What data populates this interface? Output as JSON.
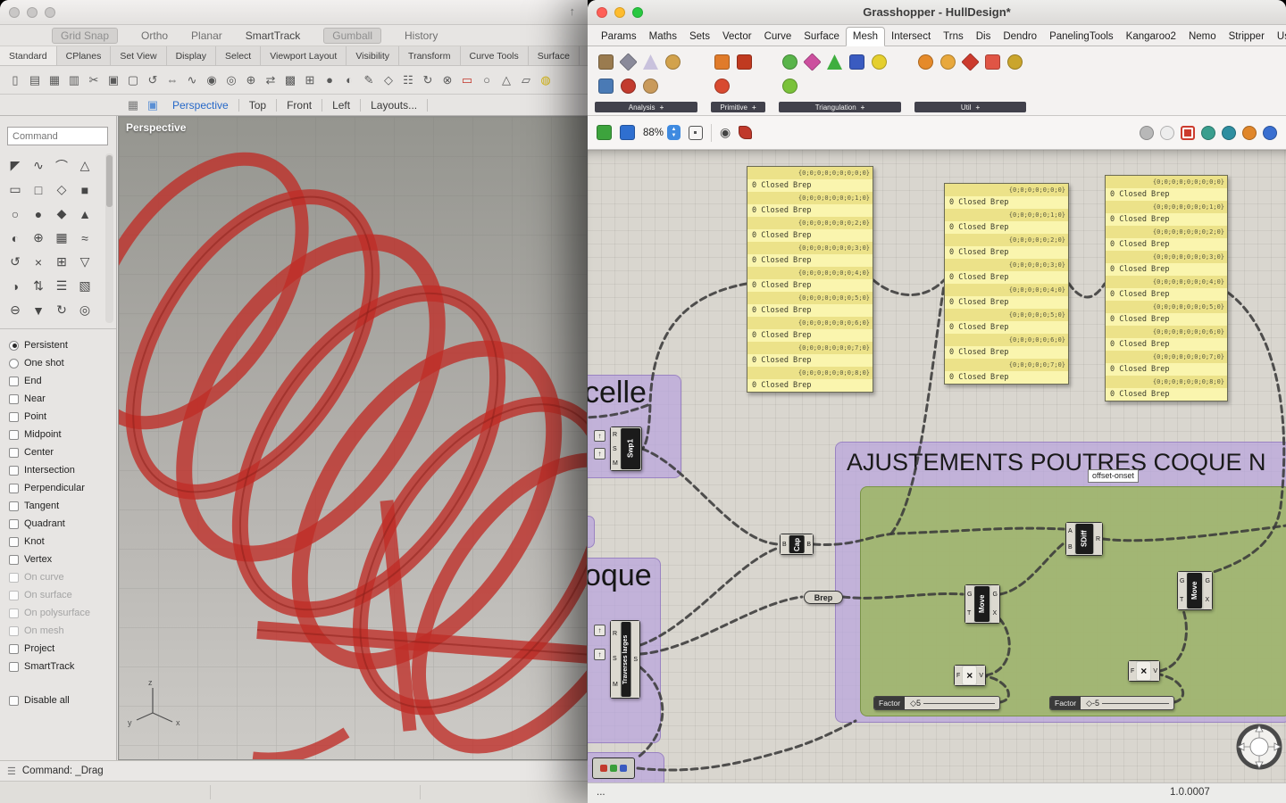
{
  "colors": {
    "accent_blue": "#3f8ae0",
    "panel_yellow": "#f8f2a0",
    "group_purple": "#b9a3dd",
    "group_green": "#9fb668",
    "wire": "#3a3a3a",
    "red_geometry": "#c03028"
  },
  "rhino": {
    "share_icon": "↑",
    "toggles": [
      {
        "label": "Grid Snap",
        "cls": "boxed"
      },
      {
        "label": "Ortho",
        "cls": "plain"
      },
      {
        "label": "Planar",
        "cls": "plain"
      },
      {
        "label": "SmartTrack",
        "cls": "strong"
      },
      {
        "label": "Gumball",
        "cls": "boxed"
      },
      {
        "label": "History",
        "cls": "plain"
      }
    ],
    "tabs": [
      {
        "label": "Standard",
        "cls": "first"
      },
      {
        "label": "CPlanes"
      },
      {
        "label": "Set View"
      },
      {
        "label": "Display"
      },
      {
        "label": "Select"
      },
      {
        "label": "Viewport Layout"
      },
      {
        "label": "Visibility"
      },
      {
        "label": "Transform"
      },
      {
        "label": "Curve Tools"
      },
      {
        "label": "Surface"
      }
    ],
    "toolbar_icons": [
      {
        "g": "▯"
      },
      {
        "g": "▤"
      },
      {
        "g": "▦"
      },
      {
        "g": "▥"
      },
      {
        "g": "✂"
      },
      {
        "g": "▣"
      },
      {
        "g": "▢"
      },
      {
        "g": "↺"
      },
      {
        "g": "⇔"
      },
      {
        "g": "∿"
      },
      {
        "g": "◉"
      },
      {
        "g": "◎"
      },
      {
        "g": "⊕"
      },
      {
        "g": "⇄"
      },
      {
        "g": "▩"
      },
      {
        "g": "⊞"
      },
      {
        "g": "●"
      },
      {
        "g": "◐"
      },
      {
        "g": "✎"
      },
      {
        "g": "◇"
      },
      {
        "g": "☷"
      },
      {
        "g": "↻"
      },
      {
        "g": "⊗"
      },
      {
        "g": "▭",
        "c": "#c23428"
      },
      {
        "g": "○"
      },
      {
        "g": "△"
      },
      {
        "g": "▱"
      },
      {
        "g": "◍",
        "c": "#d8b812"
      }
    ],
    "command_placeholder": "Command",
    "vp_icons": {
      "grid": "▦",
      "frame": "▣"
    },
    "viewport_tabs": [
      {
        "label": "Perspective",
        "cls": "active"
      },
      {
        "label": "Top"
      },
      {
        "label": "Front"
      },
      {
        "label": "Left"
      },
      {
        "label": "Layouts..."
      }
    ],
    "viewport_label": "Perspective",
    "side_icons": [
      {
        "g": "◤"
      },
      {
        "g": "∿"
      },
      {
        "g": "⌒"
      },
      {
        "g": "△"
      },
      {
        "g": "▭"
      },
      {
        "g": "□"
      },
      {
        "g": "◇"
      },
      {
        "g": "■"
      },
      {
        "g": "○"
      },
      {
        "g": "●"
      },
      {
        "g": "◆"
      },
      {
        "g": "▲"
      },
      {
        "g": "◐"
      },
      {
        "g": "⊕"
      },
      {
        "g": "▦"
      },
      {
        "g": "≈"
      },
      {
        "g": "↺"
      },
      {
        "g": "×"
      },
      {
        "g": "⊞"
      },
      {
        "g": "▽"
      },
      {
        "g": "◑"
      },
      {
        "g": "⇅"
      },
      {
        "g": "☰"
      },
      {
        "g": "▧"
      },
      {
        "g": "⊖"
      },
      {
        "g": "▼"
      },
      {
        "g": "↻"
      },
      {
        "g": "◎"
      }
    ],
    "osnap": {
      "radios": [
        {
          "label": "Persistent",
          "cls": "checked"
        },
        {
          "label": "One shot"
        }
      ],
      "checks": [
        {
          "label": "End"
        },
        {
          "label": "Near"
        },
        {
          "label": "Point"
        },
        {
          "label": "Midpoint"
        },
        {
          "label": "Center"
        },
        {
          "label": "Intersection"
        },
        {
          "label": "Perpendicular"
        },
        {
          "label": "Tangent"
        },
        {
          "label": "Quadrant"
        },
        {
          "label": "Knot"
        },
        {
          "label": "Vertex"
        },
        {
          "label": "On curve",
          "cls": "disabled"
        },
        {
          "label": "On surface",
          "cls": "disabled"
        },
        {
          "label": "On polysurface",
          "cls": "disabled"
        },
        {
          "label": "On mesh",
          "cls": "disabled"
        },
        {
          "label": "Project"
        },
        {
          "label": "SmartTrack"
        }
      ],
      "disable_all": "Disable all"
    },
    "status_icon": "☰",
    "status": "Command: _Drag"
  },
  "grasshopper": {
    "title": "Grasshopper - HullDesign*",
    "menus": [
      {
        "label": "Params"
      },
      {
        "label": "Maths"
      },
      {
        "label": "Sets"
      },
      {
        "label": "Vector"
      },
      {
        "label": "Curve"
      },
      {
        "label": "Surface"
      },
      {
        "label": "Mesh",
        "cls": "active"
      },
      {
        "label": "Intersect"
      },
      {
        "label": "Trns"
      },
      {
        "label": "Dis"
      },
      {
        "label": "Dendro"
      },
      {
        "label": "PanelingTools"
      },
      {
        "label": "Kangaroo2"
      },
      {
        "label": "Nemo"
      },
      {
        "label": "Stripper"
      },
      {
        "label": "User"
      }
    ],
    "ribbon": [
      {
        "label": "Analysis",
        "icons": [
          {
            "c": "#9a7b4f",
            "shape": "square"
          },
          {
            "c": "#8a8a9a",
            "shape": "diamond"
          },
          {
            "c": "#c9c2dd",
            "shape": "tri"
          },
          {
            "c": "#d2a24c",
            "shape": "circle"
          },
          {
            "c": "#4a7ab5",
            "shape": "square"
          },
          {
            "c": "#c23b2e",
            "shape": "circle"
          },
          {
            "c": "#c99a5b",
            "shape": "circle"
          }
        ]
      },
      {
        "label": "Primitive",
        "icons": [
          {
            "c": "#e07b2a",
            "shape": "square"
          },
          {
            "c": "#c03a20",
            "shape": "square"
          },
          {
            "c": "#d84a30",
            "shape": "circle"
          }
        ]
      },
      {
        "label": "Triangulation",
        "icons": [
          {
            "c": "#59b44a",
            "shape": "circle"
          },
          {
            "c": "#cc4f9e",
            "shape": "diamond"
          },
          {
            "c": "#3fae3f",
            "shape": "tri"
          },
          {
            "c": "#3a5bc0",
            "shape": "square"
          },
          {
            "c": "#e5cf2e",
            "shape": "circle"
          },
          {
            "c": "#7ac23a",
            "shape": "circle"
          }
        ]
      },
      {
        "label": "Util",
        "icons": [
          {
            "c": "#e58a2a",
            "shape": "circle"
          },
          {
            "c": "#e8a83c",
            "shape": "circle"
          },
          {
            "c": "#cc3b2e",
            "shape": "diamond"
          },
          {
            "c": "#e05545",
            "shape": "square"
          },
          {
            "c": "#caa52c",
            "shape": "circle"
          }
        ]
      }
    ],
    "toolbar": {
      "zoom": "88%",
      "up": "▲",
      "down": "▼"
    },
    "view_icons": [
      {
        "c": "#b8b8b8"
      },
      {
        "c": "#ededed"
      },
      {
        "c": "#cc3b2e",
        "cls": "sel"
      },
      {
        "c": "#3a9e8e"
      },
      {
        "c": "#2e8ea0"
      },
      {
        "c": "#e0862a"
      },
      {
        "c": "#3a6fd0"
      }
    ],
    "canvas": {
      "groups": {
        "celle": "celle",
        "oque": "oque",
        "ajust": "AJUSTEMENTS POUTRES COQUE N"
      },
      "tag": "offset-onset",
      "grip": "◇",
      "graft": "↑",
      "panels": {
        "a": {
          "rows": [
            {
              "t": "path",
              "v": "{0;0;0;0;0;0;0;0;0}"
            },
            {
              "t": "item",
              "v": "0 Closed Brep"
            },
            {
              "t": "path",
              "v": "{0;0;0;0;0;0;0;1;0}"
            },
            {
              "t": "item",
              "v": "0 Closed Brep"
            },
            {
              "t": "path",
              "v": "{0;0;0;0;0;0;0;2;0}"
            },
            {
              "t": "item",
              "v": "0 Closed Brep"
            },
            {
              "t": "path",
              "v": "{0;0;0;0;0;0;0;3;0}"
            },
            {
              "t": "item",
              "v": "0 Closed Brep"
            },
            {
              "t": "path",
              "v": "{0;0;0;0;0;0;0;4;0}"
            },
            {
              "t": "item",
              "v": "0 Closed Brep"
            },
            {
              "t": "path",
              "v": "{0;0;0;0;0;0;0;5;0}"
            },
            {
              "t": "item",
              "v": "0 Closed Brep"
            },
            {
              "t": "path",
              "v": "{0;0;0;0;0;0;0;6;0}"
            },
            {
              "t": "item",
              "v": "0 Closed Brep"
            },
            {
              "t": "path",
              "v": "{0;0;0;0;0;0;0;7;0}"
            },
            {
              "t": "item",
              "v": "0 Closed Brep"
            },
            {
              "t": "path",
              "v": "{0;0;0;0;0;0;0;8;0}"
            },
            {
              "t": "item",
              "v": "0 Closed Brep"
            }
          ]
        },
        "b": {
          "rows": [
            {
              "t": "path",
              "v": "{0;0;0;0;0;0;0}"
            },
            {
              "t": "item",
              "v": "0 Closed Brep"
            },
            {
              "t": "path",
              "v": "{0;0;0;0;0;1;0}"
            },
            {
              "t": "item",
              "v": "0 Closed Brep"
            },
            {
              "t": "path",
              "v": "{0;0;0;0;0;2;0}"
            },
            {
              "t": "item",
              "v": "0 Closed Brep"
            },
            {
              "t": "path",
              "v": "{0;0;0;0;0;3;0}"
            },
            {
              "t": "item",
              "v": "0 Closed Brep"
            },
            {
              "t": "path",
              "v": "{0;0;0;0;0;4;0}"
            },
            {
              "t": "item",
              "v": "0 Closed Brep"
            },
            {
              "t": "path",
              "v": "{0;0;0;0;0;5;0}"
            },
            {
              "t": "item",
              "v": "0 Closed Brep"
            },
            {
              "t": "path",
              "v": "{0;0;0;0;0;6;0}"
            },
            {
              "t": "item",
              "v": "0 Closed Brep"
            },
            {
              "t": "path",
              "v": "{0;0;0;0;0;7;0}"
            },
            {
              "t": "item",
              "v": "0 Closed Brep"
            }
          ]
        },
        "c": {
          "rows": [
            {
              "t": "path",
              "v": "{0;0;0;0;0;0;0;0;0}"
            },
            {
              "t": "item",
              "v": "0 Closed Brep"
            },
            {
              "t": "path",
              "v": "{0;0;0;0;0;0;0;1;0}"
            },
            {
              "t": "item",
              "v": "0 Closed Brep"
            },
            {
              "t": "path",
              "v": "{0;0;0;0;0;0;0;2;0}"
            },
            {
              "t": "item",
              "v": "0 Closed Brep"
            },
            {
              "t": "path",
              "v": "{0;0;0;0;0;0;0;3;0}"
            },
            {
              "t": "item",
              "v": "0 Closed Brep"
            },
            {
              "t": "path",
              "v": "{0;0;0;0;0;0;0;4;0}"
            },
            {
              "t": "item",
              "v": "0 Closed Brep"
            },
            {
              "t": "path",
              "v": "{0;0;0;0;0;0;0;5;0}"
            },
            {
              "t": "item",
              "v": "0 Closed Brep"
            },
            {
              "t": "path",
              "v": "{0;0;0;0;0;0;0;6;0}"
            },
            {
              "t": "item",
              "v": "0 Closed Brep"
            },
            {
              "t": "path",
              "v": "{0;0;0;0;0;0;0;7;0}"
            },
            {
              "t": "item",
              "v": "0 Closed Brep"
            },
            {
              "t": "path",
              "v": "{0;0;0;0;0;0;0;8;0}"
            },
            {
              "t": "item",
              "v": "0 Closed Brep"
            }
          ]
        }
      },
      "components": {
        "swp1": {
          "name": "Swp1",
          "p1": "R",
          "p2": "S",
          "p3": "M"
        },
        "traverses": {
          "name": "Traverses larges",
          "p1": "R",
          "p2": "S",
          "p3": "M",
          "out": "S"
        },
        "cap": {
          "name": "Cap",
          "in": "B",
          "out": "B"
        },
        "brep": {
          "name": "Brep"
        },
        "sdiff": {
          "name": "SDiff",
          "in1": "A",
          "in2": "B",
          "out": "R"
        },
        "move": {
          "name": "Move",
          "in1": "G",
          "in2": "T",
          "out1": "G",
          "out2": "X"
        },
        "mul": {
          "symbol": "×",
          "in": "F",
          "out": "V"
        },
        "slider1": {
          "label": "Factor",
          "value": "5"
        },
        "slider2": {
          "label": "Factor",
          "value": "-5"
        }
      }
    },
    "status": {
      "left": "...",
      "version": "1.0.0007"
    }
  }
}
